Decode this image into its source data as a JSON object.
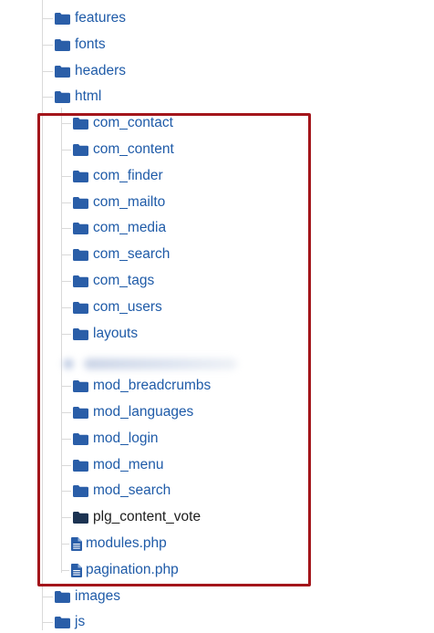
{
  "tree": {
    "top_folders": [
      {
        "label": "features",
        "icon": "folder-icon"
      },
      {
        "label": "fonts",
        "icon": "folder-icon"
      },
      {
        "label": "headers",
        "icon": "folder-icon"
      },
      {
        "label": "html",
        "icon": "folder-icon"
      }
    ],
    "html_children": [
      {
        "label": "com_contact",
        "icon": "folder-icon"
      },
      {
        "label": "com_content",
        "icon": "folder-icon"
      },
      {
        "label": "com_finder",
        "icon": "folder-icon"
      },
      {
        "label": "com_mailto",
        "icon": "folder-icon"
      },
      {
        "label": "com_media",
        "icon": "folder-icon"
      },
      {
        "label": "com_search",
        "icon": "folder-icon"
      },
      {
        "label": "com_tags",
        "icon": "folder-icon"
      },
      {
        "label": "com_users",
        "icon": "folder-icon"
      },
      {
        "label": "layouts",
        "icon": "folder-icon"
      },
      {
        "label": "mod_breadcrumbs",
        "icon": "folder-icon"
      },
      {
        "label": "mod_languages",
        "icon": "folder-icon"
      },
      {
        "label": "mod_login",
        "icon": "folder-icon"
      },
      {
        "label": "mod_menu",
        "icon": "folder-icon"
      },
      {
        "label": "mod_search",
        "icon": "folder-icon"
      },
      {
        "label": "plg_content_vote",
        "icon": "folder-icon",
        "state": "selected"
      },
      {
        "label": "modules.php",
        "icon": "file-icon"
      },
      {
        "label": "pagination.php",
        "icon": "file-icon"
      }
    ],
    "bottom_folders": [
      {
        "label": "images",
        "icon": "folder-icon"
      },
      {
        "label": "js",
        "icon": "folder-icon"
      }
    ]
  },
  "colors": {
    "link": "#1f5ba8",
    "folder": "#2a5ea8",
    "folder_active": "#1c3352",
    "highlight_border": "#a3151b",
    "tree_lines": "#d9d9d9"
  }
}
